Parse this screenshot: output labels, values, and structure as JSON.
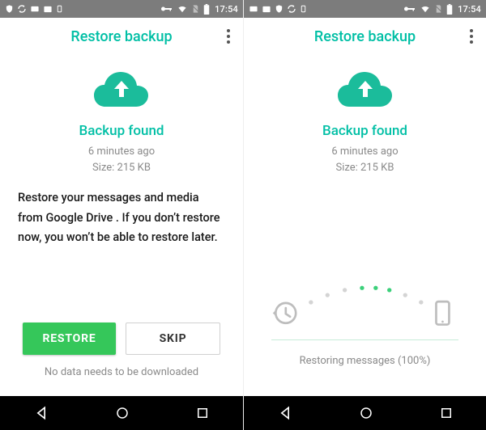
{
  "accent": "#00bfa5",
  "statusbar": {
    "time": "17:54"
  },
  "appbar": {
    "title": "Restore backup"
  },
  "backup": {
    "heading": "Backup found",
    "age": "6 minutes ago",
    "size": "Size: 215 KB"
  },
  "left": {
    "description": "Restore your messages and media from Google Drive . If you don’t restore now, you won’t be able to restore later.",
    "restore_label": "RESTORE",
    "skip_label": "SKIP",
    "footnote": "No data needs to be downloaded"
  },
  "right": {
    "progress_label": "Restoring messages (100%)"
  }
}
